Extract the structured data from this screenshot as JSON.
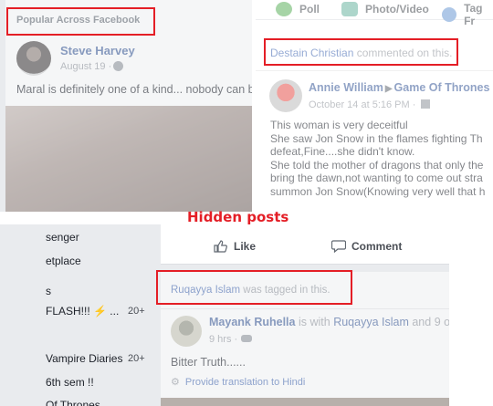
{
  "annotation": {
    "label": "Hidden posts",
    "color": "#e41e26"
  },
  "panel_popular": {
    "header": "Popular Across Facebook",
    "author": "Steve Harvey",
    "date": "August 19 ·",
    "text": "Maral is definitely one of a kind... nobody can b"
  },
  "panel_comment": {
    "composer": {
      "poll": "Poll",
      "photo_video": "Photo/Video",
      "tag": "Tag Fr"
    },
    "activity_actor": "Destain Christian",
    "activity_text": "commented on this.",
    "author": "Annie William",
    "page": "Game Of Thrones",
    "meta": "October 14 at 5:16 PM ·",
    "lines": [
      "This woman is very deceitful",
      "She saw Jon Snow in the flames fighting Th",
      "defeat,Fine....she didn't know.",
      "She told the mother of dragons that only the",
      "bring the dawn,not wanting to come out stra",
      "summon Jon Snow(Knowing very well that h"
    ]
  },
  "sidebar": {
    "items": [
      {
        "label": "senger",
        "count": ""
      },
      {
        "label": "etplace",
        "count": ""
      },
      {
        "label": "s",
        "count": ""
      },
      {
        "label": "FLASH!!! ⚡ ...",
        "count": "20+"
      },
      {
        "label": "Vampire Diaries",
        "count": "20+"
      },
      {
        "label": "6th sem !!",
        "count": ""
      },
      {
        "label": "Of Thrones",
        "count": ""
      }
    ]
  },
  "panel_tagged": {
    "like_label": "Like",
    "comment_label": "Comment",
    "activity_actor": "Ruqayya Islam",
    "activity_text": "was tagged in this.",
    "author": "Mayank Ruhella",
    "with_text": "is with",
    "tagged": "Ruqayya Islam",
    "and_text": "and 9 o",
    "meta": "9 hrs ·",
    "text": "Bitter Truth......",
    "translate": "Provide translation to Hindi"
  }
}
